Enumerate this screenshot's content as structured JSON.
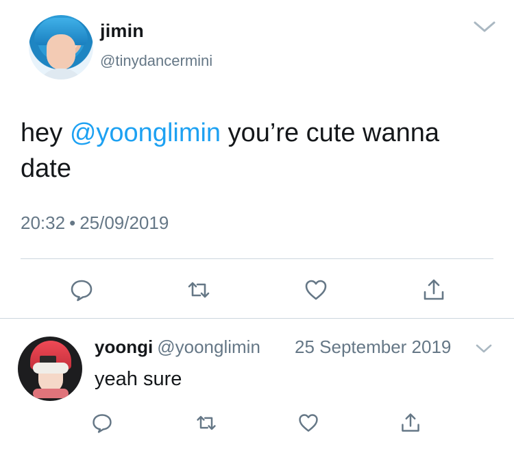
{
  "main_tweet": {
    "author_name": "jimin",
    "author_handle": "@tinydancermini",
    "text_prefix": "hey ",
    "mention": "@yoonglimin",
    "text_suffix": " you’re cute wanna date",
    "time": "20:32",
    "separator": "•",
    "date": "25/09/2019"
  },
  "reply_tweet": {
    "author_name": "yoongi",
    "author_handle": "@yoonglimin",
    "date": "25 September 2019",
    "text": "yeah sure"
  },
  "icons": {
    "reply": "speech-bubble-icon",
    "retweet": "retweet-arrows-icon",
    "like": "heart-icon",
    "share": "share-upload-icon",
    "more": "chevron-down-icon"
  },
  "colors": {
    "text": "#14171a",
    "secondary": "#657786",
    "link": "#1da1f2",
    "divider": "#ccd6dd"
  }
}
